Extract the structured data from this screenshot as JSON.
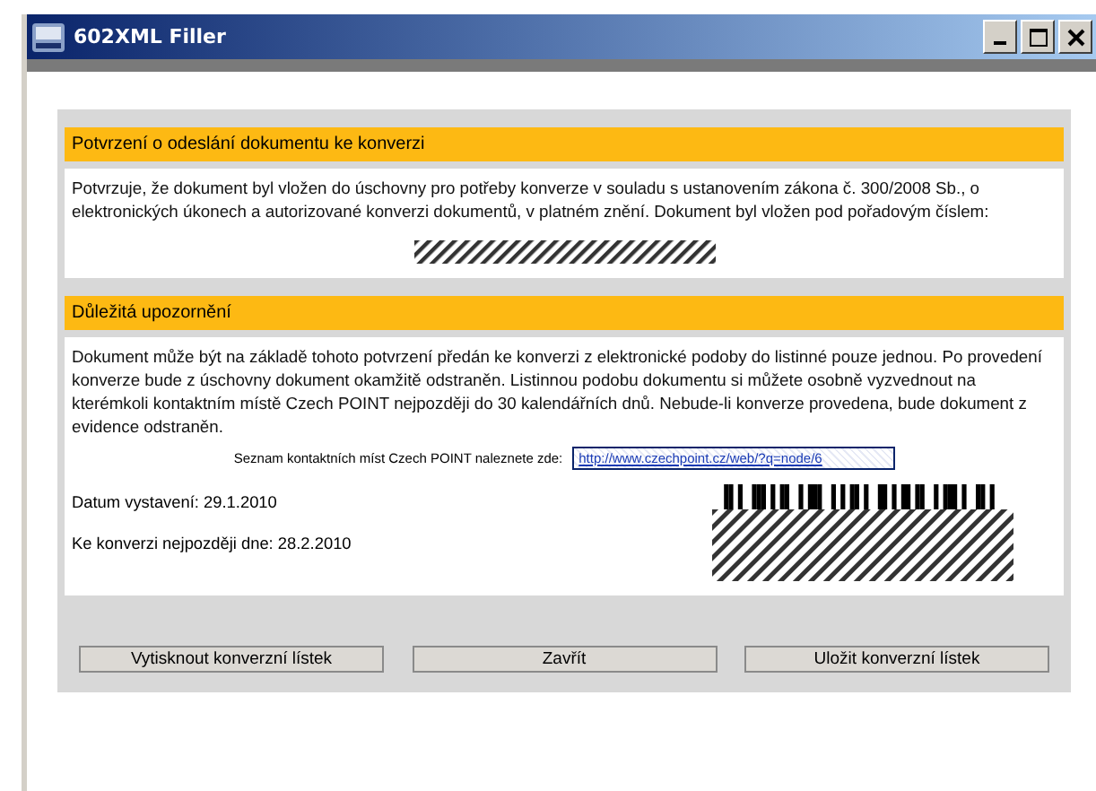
{
  "window": {
    "title": "602XML Filler"
  },
  "sections": [
    {
      "title": "Potvrzení o odeslání dokumentu ke konverzi",
      "text": "Potvrzuje, že dokument byl vložen do úschovny pro potřeby konverze v souladu s ustanovením zákona č. 300/2008 Sb., o elektronických úkonech a autorizované konverzi dokumentů, v platném znění. Dokument byl vložen pod pořadovým číslem:"
    },
    {
      "title": "Důležitá upozornění",
      "text": "Dokument může být na základě tohoto potvrzení předán ke konverzi z elektronické podoby do listinné pouze jednou. Po provedení konverze bude z úschovny dokument okamžitě odstraněn. Listinnou podobu dokumentu si můžete osobně vyzvednout na kterémkoli kontaktním místě Czech POINT nejpozději do 30 kalendářních dnů. Nebude-li konverze provedena, bude dokument z evidence odstraněn."
    }
  ],
  "link_label": "Seznam kontaktních míst Czech POINT naleznete zde:",
  "link_value": "http://www.czechpoint.cz/web/?q=node/6",
  "issue_date": "Datum vystavení: 29.1.2010",
  "deadline": "Ke konverzi nejpozději dne: 28.2.2010",
  "buttons": [
    "Vytisknout konverzní lístek",
    "Zavřít",
    "Uložit konverzní lístek"
  ]
}
